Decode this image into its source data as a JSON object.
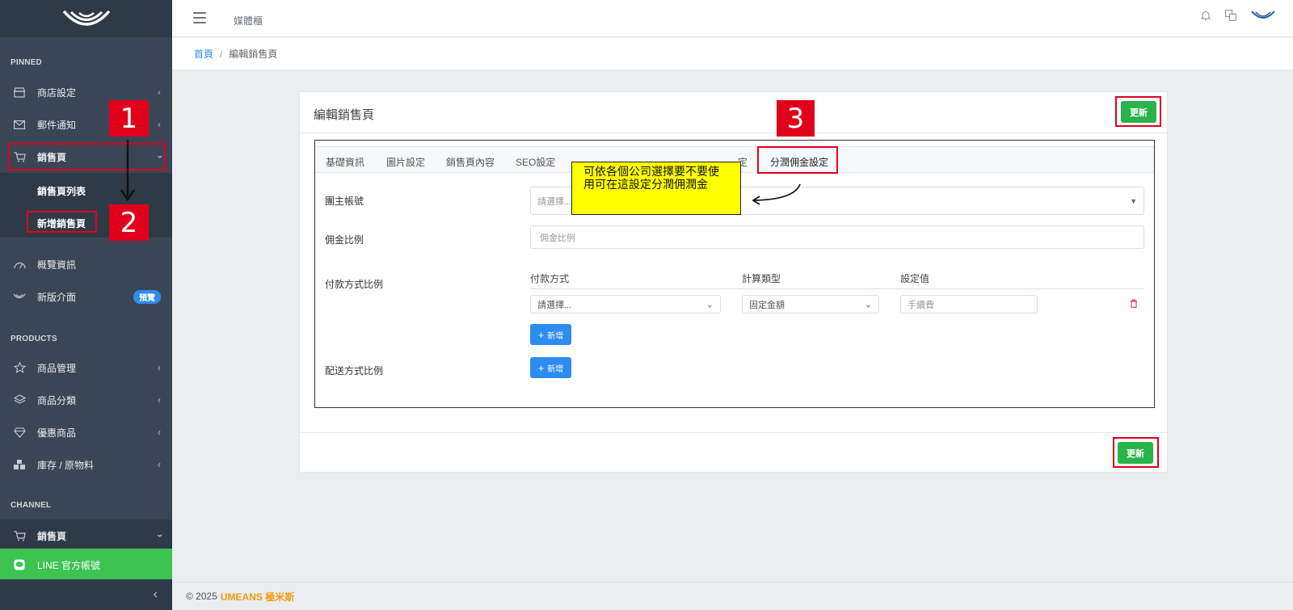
{
  "topbar": {
    "title": "媒體櫃"
  },
  "sidebar": {
    "sections": {
      "pinned": "PINNED",
      "products": "PRODUCTS",
      "channel": "CHANNEL"
    },
    "items": {
      "store_settings": "商店設定",
      "mail_notify": "郵件通知",
      "sales_page": "銷售頁",
      "sales_page_list": "銷售頁列表",
      "new_sales_page": "新增銷售頁",
      "overview": "概覽資訊",
      "new_ui": "新版介面",
      "new_ui_badge": "預覽",
      "product_mgmt": "商品管理",
      "product_category": "商品分類",
      "discount_product": "優惠商品",
      "inventory": "庫存 / 原物料",
      "channel_sales_page": "銷售頁",
      "line_official": "LINE 官方帳號"
    }
  },
  "breadcrumb": {
    "home": "首頁",
    "separator": "/",
    "current": "編輯銷售頁"
  },
  "card": {
    "title": "編輯銷售頁",
    "update_label": "更新",
    "tabs": [
      "基礎資訊",
      "圖片設定",
      "銷售頁內容",
      "SEO設定",
      "定",
      "分潤佣金設定"
    ],
    "form": {
      "group_owner_label": "團主帳號",
      "group_owner_placeholder": "請選擇...",
      "commission_label": "佣金比例",
      "commission_placeholder": "佣金比例",
      "payment_ratio_label": "付款方式比例",
      "col_payment": "付款方式",
      "col_calc_type": "計算類型",
      "col_value": "設定值",
      "payment_select": "請選擇...",
      "calc_select": "固定金額",
      "value_placeholder": "手續費",
      "add_label": "新增",
      "shipping_ratio_label": "配送方式比例"
    }
  },
  "annotations": {
    "step1": "1",
    "step2": "2",
    "step3": "3",
    "callout_text": "可依各個公司選擇要不要使用可在這設定分潤佣潤金"
  },
  "footer": {
    "copyright": "© 2025",
    "brand": "UMEANS 極米斯"
  },
  "colors": {
    "sidebar": "#3a4655",
    "accent_green": "#28b44b",
    "accent_blue": "#2d8cf0",
    "annotation_red": "#e0001b",
    "callout_yellow": "#ffff00"
  }
}
